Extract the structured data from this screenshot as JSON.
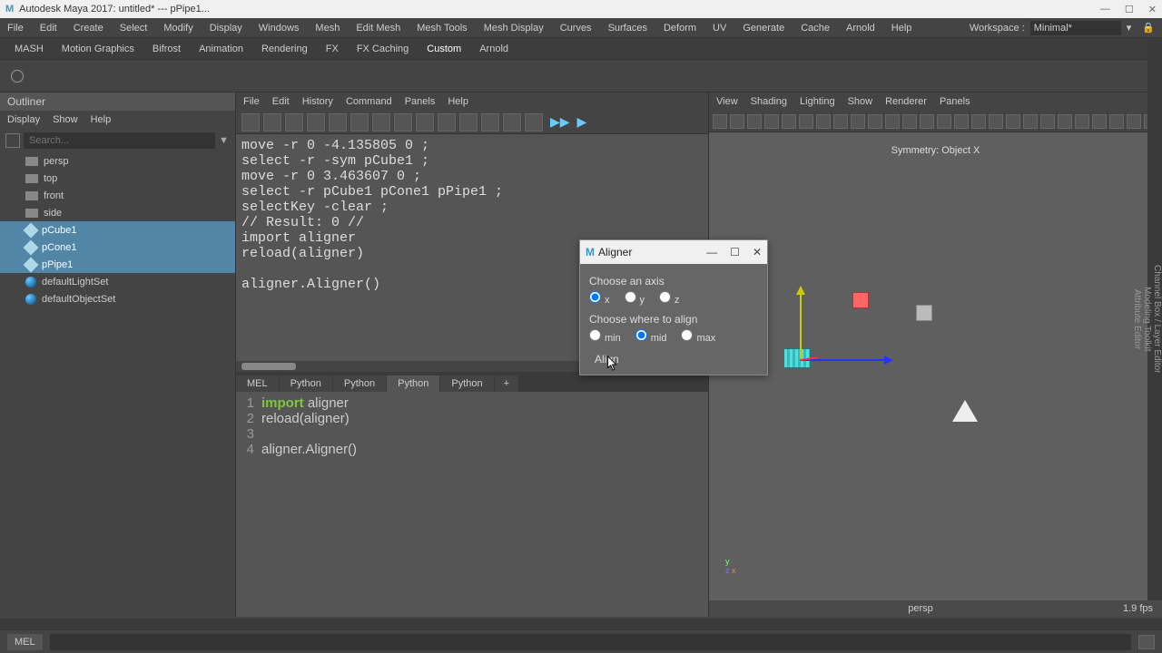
{
  "titlebar": {
    "text": "Autodesk Maya 2017: untitled* --- pPipe1...",
    "min": "—",
    "max": "☐",
    "close": "✕"
  },
  "menubar": {
    "items": [
      "File",
      "Edit",
      "Create",
      "Select",
      "Modify",
      "Display",
      "Windows",
      "Mesh",
      "Edit Mesh",
      "Mesh Tools",
      "Mesh Display",
      "Curves",
      "Surfaces",
      "Deform",
      "UV",
      "Generate",
      "Cache",
      "Arnold",
      "Help"
    ],
    "workspace_label": "Workspace :",
    "workspace_value": "Minimal*"
  },
  "shelf": {
    "tabs": [
      "MASH",
      "Motion Graphics",
      "Bifrost",
      "Animation",
      "Rendering",
      "FX",
      "FX Caching",
      "Custom",
      "Arnold"
    ],
    "active": 7
  },
  "outliner": {
    "title": "Outliner",
    "menus": [
      "Display",
      "Show",
      "Help"
    ],
    "search_placeholder": "Search...",
    "items": [
      {
        "name": "persp",
        "sel": false,
        "kind": "cam"
      },
      {
        "name": "top",
        "sel": false,
        "kind": "cam"
      },
      {
        "name": "front",
        "sel": false,
        "kind": "cam"
      },
      {
        "name": "side",
        "sel": false,
        "kind": "cam"
      },
      {
        "name": "pCube1",
        "sel": true,
        "kind": "mesh"
      },
      {
        "name": "pCone1",
        "sel": true,
        "kind": "mesh"
      },
      {
        "name": "pPipe1",
        "sel": true,
        "kind": "mesh"
      },
      {
        "name": "defaultLightSet",
        "sel": false,
        "kind": "set"
      },
      {
        "name": "defaultObjectSet",
        "sel": false,
        "kind": "set"
      }
    ]
  },
  "script_editor": {
    "menus": [
      "File",
      "Edit",
      "History",
      "Command",
      "Panels",
      "Help"
    ],
    "output_lines": [
      "move -r 0 -4.135805 0 ;",
      "select -r -sym pCube1 ;",
      "move -r 0 3.463607 0 ;",
      "select -r pCube1 pCone1 pPipe1 ;",
      "selectKey -clear ;",
      "// Result: 0 //",
      "import aligner",
      "reload(aligner)",
      "",
      "aligner.Aligner()"
    ],
    "tabs": [
      "MEL",
      "Python",
      "Python",
      "Python",
      "Python"
    ],
    "active_tab": 3,
    "plus": "+",
    "input_lines": [
      {
        "n": "1",
        "pre": "import",
        "post": " aligner"
      },
      {
        "n": "2",
        "pre": "",
        "post": "reload(aligner)"
      },
      {
        "n": "3",
        "pre": "",
        "post": ""
      },
      {
        "n": "4",
        "pre": "",
        "post": "aligner.Aligner()"
      }
    ]
  },
  "viewport": {
    "menus": [
      "View",
      "Shading",
      "Lighting",
      "Show",
      "Renderer",
      "Panels"
    ],
    "symmetry": "Symmetry: Object X",
    "camera": "persp",
    "fps": "1.9 fps",
    "axis": {
      "y": "y",
      "x": "x",
      "z": "z"
    }
  },
  "side_tabs": [
    "Channel Box / Layer Editor",
    "Modeling Toolkit",
    "Attribute Editor"
  ],
  "dialog": {
    "title": "Aligner",
    "min": "—",
    "max": "☐",
    "close": "✕",
    "axis_label": "Choose an axis",
    "axes": [
      "x",
      "y",
      "z"
    ],
    "axis_selected": 0,
    "align_label": "Choose where to align",
    "modes": [
      "min",
      "mid",
      "max"
    ],
    "mode_selected": 1,
    "button": "Align"
  },
  "cmdline": {
    "label": "MEL"
  }
}
